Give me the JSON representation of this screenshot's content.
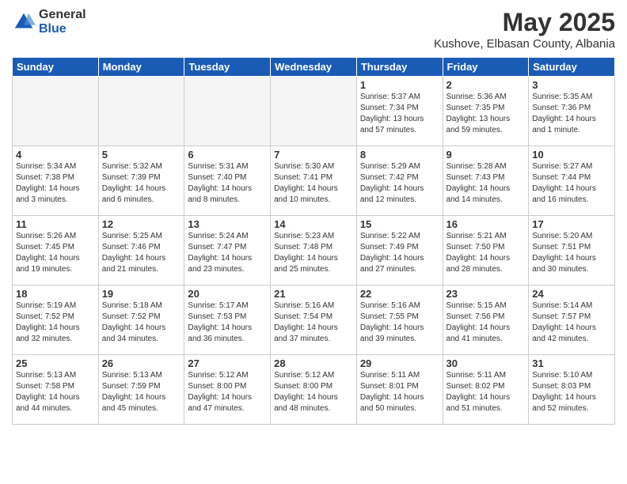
{
  "logo": {
    "general": "General",
    "blue": "Blue"
  },
  "header": {
    "month": "May 2025",
    "location": "Kushove, Elbasan County, Albania"
  },
  "weekdays": [
    "Sunday",
    "Monday",
    "Tuesday",
    "Wednesday",
    "Thursday",
    "Friday",
    "Saturday"
  ],
  "weeks": [
    [
      {
        "day": "",
        "info": ""
      },
      {
        "day": "",
        "info": ""
      },
      {
        "day": "",
        "info": ""
      },
      {
        "day": "",
        "info": ""
      },
      {
        "day": "1",
        "info": "Sunrise: 5:37 AM\nSunset: 7:34 PM\nDaylight: 13 hours and 57 minutes."
      },
      {
        "day": "2",
        "info": "Sunrise: 5:36 AM\nSunset: 7:35 PM\nDaylight: 13 hours and 59 minutes."
      },
      {
        "day": "3",
        "info": "Sunrise: 5:35 AM\nSunset: 7:36 PM\nDaylight: 14 hours and 1 minute."
      }
    ],
    [
      {
        "day": "4",
        "info": "Sunrise: 5:34 AM\nSunset: 7:38 PM\nDaylight: 14 hours and 3 minutes."
      },
      {
        "day": "5",
        "info": "Sunrise: 5:32 AM\nSunset: 7:39 PM\nDaylight: 14 hours and 6 minutes."
      },
      {
        "day": "6",
        "info": "Sunrise: 5:31 AM\nSunset: 7:40 PM\nDaylight: 14 hours and 8 minutes."
      },
      {
        "day": "7",
        "info": "Sunrise: 5:30 AM\nSunset: 7:41 PM\nDaylight: 14 hours and 10 minutes."
      },
      {
        "day": "8",
        "info": "Sunrise: 5:29 AM\nSunset: 7:42 PM\nDaylight: 14 hours and 12 minutes."
      },
      {
        "day": "9",
        "info": "Sunrise: 5:28 AM\nSunset: 7:43 PM\nDaylight: 14 hours and 14 minutes."
      },
      {
        "day": "10",
        "info": "Sunrise: 5:27 AM\nSunset: 7:44 PM\nDaylight: 14 hours and 16 minutes."
      }
    ],
    [
      {
        "day": "11",
        "info": "Sunrise: 5:26 AM\nSunset: 7:45 PM\nDaylight: 14 hours and 19 minutes."
      },
      {
        "day": "12",
        "info": "Sunrise: 5:25 AM\nSunset: 7:46 PM\nDaylight: 14 hours and 21 minutes."
      },
      {
        "day": "13",
        "info": "Sunrise: 5:24 AM\nSunset: 7:47 PM\nDaylight: 14 hours and 23 minutes."
      },
      {
        "day": "14",
        "info": "Sunrise: 5:23 AM\nSunset: 7:48 PM\nDaylight: 14 hours and 25 minutes."
      },
      {
        "day": "15",
        "info": "Sunrise: 5:22 AM\nSunset: 7:49 PM\nDaylight: 14 hours and 27 minutes."
      },
      {
        "day": "16",
        "info": "Sunrise: 5:21 AM\nSunset: 7:50 PM\nDaylight: 14 hours and 28 minutes."
      },
      {
        "day": "17",
        "info": "Sunrise: 5:20 AM\nSunset: 7:51 PM\nDaylight: 14 hours and 30 minutes."
      }
    ],
    [
      {
        "day": "18",
        "info": "Sunrise: 5:19 AM\nSunset: 7:52 PM\nDaylight: 14 hours and 32 minutes."
      },
      {
        "day": "19",
        "info": "Sunrise: 5:18 AM\nSunset: 7:52 PM\nDaylight: 14 hours and 34 minutes."
      },
      {
        "day": "20",
        "info": "Sunrise: 5:17 AM\nSunset: 7:53 PM\nDaylight: 14 hours and 36 minutes."
      },
      {
        "day": "21",
        "info": "Sunrise: 5:16 AM\nSunset: 7:54 PM\nDaylight: 14 hours and 37 minutes."
      },
      {
        "day": "22",
        "info": "Sunrise: 5:16 AM\nSunset: 7:55 PM\nDaylight: 14 hours and 39 minutes."
      },
      {
        "day": "23",
        "info": "Sunrise: 5:15 AM\nSunset: 7:56 PM\nDaylight: 14 hours and 41 minutes."
      },
      {
        "day": "24",
        "info": "Sunrise: 5:14 AM\nSunset: 7:57 PM\nDaylight: 14 hours and 42 minutes."
      }
    ],
    [
      {
        "day": "25",
        "info": "Sunrise: 5:13 AM\nSunset: 7:58 PM\nDaylight: 14 hours and 44 minutes."
      },
      {
        "day": "26",
        "info": "Sunrise: 5:13 AM\nSunset: 7:59 PM\nDaylight: 14 hours and 45 minutes."
      },
      {
        "day": "27",
        "info": "Sunrise: 5:12 AM\nSunset: 8:00 PM\nDaylight: 14 hours and 47 minutes."
      },
      {
        "day": "28",
        "info": "Sunrise: 5:12 AM\nSunset: 8:00 PM\nDaylight: 14 hours and 48 minutes."
      },
      {
        "day": "29",
        "info": "Sunrise: 5:11 AM\nSunset: 8:01 PM\nDaylight: 14 hours and 50 minutes."
      },
      {
        "day": "30",
        "info": "Sunrise: 5:11 AM\nSunset: 8:02 PM\nDaylight: 14 hours and 51 minutes."
      },
      {
        "day": "31",
        "info": "Sunrise: 5:10 AM\nSunset: 8:03 PM\nDaylight: 14 hours and 52 minutes."
      }
    ]
  ]
}
